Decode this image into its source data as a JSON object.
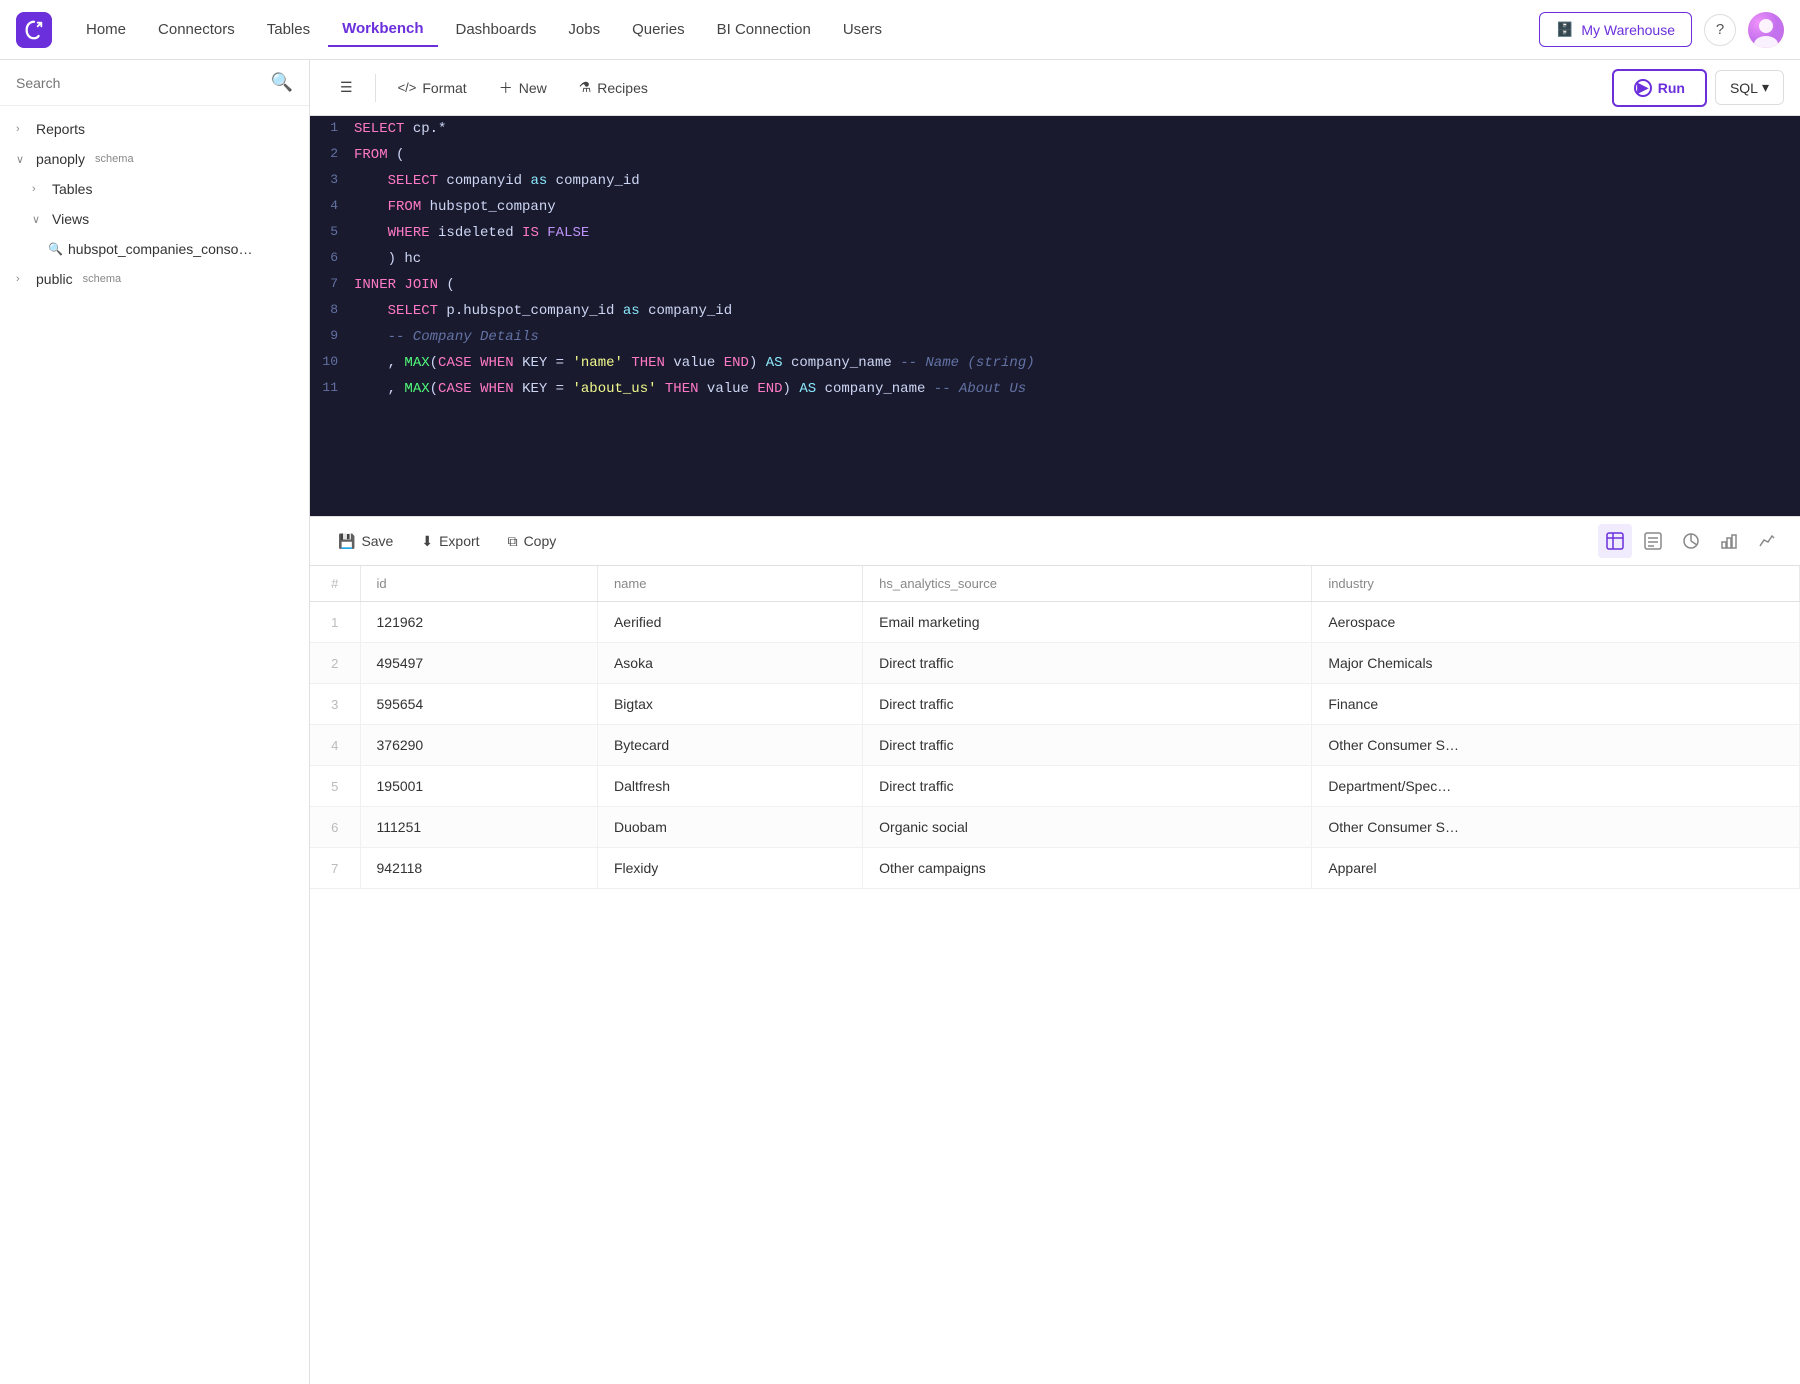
{
  "nav": {
    "items": [
      {
        "label": "Home",
        "active": false
      },
      {
        "label": "Connectors",
        "active": false
      },
      {
        "label": "Tables",
        "active": false
      },
      {
        "label": "Workbench",
        "active": true
      },
      {
        "label": "Dashboards",
        "active": false
      },
      {
        "label": "Jobs",
        "active": false
      },
      {
        "label": "Queries",
        "active": false
      },
      {
        "label": "BI Connection",
        "active": false
      },
      {
        "label": "Users",
        "active": false
      }
    ],
    "warehouse_label": "My Warehouse",
    "help_icon": "?",
    "run_label": "Run",
    "sql_label": "SQL"
  },
  "sidebar": {
    "search_placeholder": "Search",
    "tree": [
      {
        "id": "reports",
        "label": "Reports",
        "level": 0,
        "chevron": "›",
        "expanded": false
      },
      {
        "id": "panoply",
        "label": "panoply",
        "badge": "schema",
        "level": 0,
        "chevron": "∨",
        "expanded": true
      },
      {
        "id": "tables",
        "label": "Tables",
        "level": 1,
        "chevron": "›",
        "expanded": false
      },
      {
        "id": "views",
        "label": "Views",
        "level": 1,
        "chevron": "∨",
        "expanded": true
      },
      {
        "id": "hubspot",
        "label": "hubspot_companies_conso…",
        "level": 2,
        "icon": "search"
      },
      {
        "id": "public",
        "label": "public",
        "badge": "schema",
        "level": 0,
        "chevron": "›",
        "expanded": false
      }
    ]
  },
  "toolbar": {
    "format_label": "Format",
    "new_label": "New",
    "recipes_label": "Recipes"
  },
  "code_lines": [
    {
      "num": 1,
      "tokens": [
        {
          "t": "kw",
          "v": "SELECT"
        },
        {
          "t": "ident",
          "v": " cp.*"
        }
      ]
    },
    {
      "num": 2,
      "tokens": [
        {
          "t": "kw",
          "v": "FROM"
        },
        {
          "t": "ident",
          "v": " ("
        }
      ]
    },
    {
      "num": 3,
      "tokens": [
        {
          "t": "",
          "v": "    "
        },
        {
          "t": "kw",
          "v": "SELECT"
        },
        {
          "t": "ident",
          "v": " companyid "
        },
        {
          "t": "kw2",
          "v": "as"
        },
        {
          "t": "ident",
          "v": " company_id"
        }
      ]
    },
    {
      "num": 4,
      "tokens": [
        {
          "t": "",
          "v": "    "
        },
        {
          "t": "kw",
          "v": "FROM"
        },
        {
          "t": "ident",
          "v": " hubspot_company"
        }
      ]
    },
    {
      "num": 5,
      "tokens": [
        {
          "t": "",
          "v": "    "
        },
        {
          "t": "kw",
          "v": "WHERE"
        },
        {
          "t": "ident",
          "v": " isdeleted "
        },
        {
          "t": "kw",
          "v": "IS"
        },
        {
          "t": "val",
          "v": " FALSE"
        }
      ]
    },
    {
      "num": 6,
      "tokens": [
        {
          "t": "ident",
          "v": "    ) hc"
        }
      ]
    },
    {
      "num": 7,
      "tokens": [
        {
          "t": "kw",
          "v": "INNER"
        },
        {
          "t": "ident",
          "v": " "
        },
        {
          "t": "kw",
          "v": "JOIN"
        },
        {
          "t": "ident",
          "v": " ("
        }
      ]
    },
    {
      "num": 8,
      "tokens": [
        {
          "t": "",
          "v": "    "
        },
        {
          "t": "kw",
          "v": "SELECT"
        },
        {
          "t": "ident",
          "v": " p.hubspot_company_id "
        },
        {
          "t": "kw2",
          "v": "as"
        },
        {
          "t": "ident",
          "v": " company_id"
        }
      ]
    },
    {
      "num": 9,
      "tokens": [
        {
          "t": "comment",
          "v": "    -- Company Details"
        }
      ]
    },
    {
      "num": 10,
      "tokens": [
        {
          "t": "",
          "v": "    "
        },
        {
          "t": "ident",
          "v": ", "
        },
        {
          "t": "fn",
          "v": "MAX"
        },
        {
          "t": "ident",
          "v": "("
        },
        {
          "t": "kw",
          "v": "CASE"
        },
        {
          "t": "ident",
          "v": " "
        },
        {
          "t": "kw",
          "v": "WHEN"
        },
        {
          "t": "ident",
          "v": " KEY = "
        },
        {
          "t": "str",
          "v": "'name'"
        },
        {
          "t": "ident",
          "v": " "
        },
        {
          "t": "kw",
          "v": "THEN"
        },
        {
          "t": "ident",
          "v": " value "
        },
        {
          "t": "kw",
          "v": "END"
        },
        {
          "t": "ident",
          "v": ") "
        },
        {
          "t": "kw2",
          "v": "AS"
        },
        {
          "t": "ident",
          "v": " company_name "
        },
        {
          "t": "comment",
          "v": "-- Name (string)"
        }
      ]
    },
    {
      "num": 11,
      "tokens": [
        {
          "t": "",
          "v": "    "
        },
        {
          "t": "ident",
          "v": ", "
        },
        {
          "t": "fn",
          "v": "MAX"
        },
        {
          "t": "ident",
          "v": "("
        },
        {
          "t": "kw",
          "v": "CASE"
        },
        {
          "t": "ident",
          "v": " "
        },
        {
          "t": "kw",
          "v": "WHEN"
        },
        {
          "t": "ident",
          "v": " KEY = "
        },
        {
          "t": "str",
          "v": "'about_us'"
        },
        {
          "t": "ident",
          "v": " "
        },
        {
          "t": "kw",
          "v": "THEN"
        },
        {
          "t": "ident",
          "v": " value "
        },
        {
          "t": "kw",
          "v": "END"
        },
        {
          "t": "ident",
          "v": ") "
        },
        {
          "t": "kw2",
          "v": "AS"
        },
        {
          "t": "ident",
          "v": " company_name "
        },
        {
          "t": "comment",
          "v": "-- About Us"
        }
      ]
    }
  ],
  "results": {
    "save_label": "Save",
    "export_label": "Export",
    "copy_label": "Copy",
    "columns": [
      "#",
      "id",
      "name",
      "hs_analytics_source",
      "industry"
    ],
    "rows": [
      {
        "num": 1,
        "id": "121962",
        "name": "Aerified",
        "hs_analytics_source": "Email marketing",
        "industry": "Aerospace"
      },
      {
        "num": 2,
        "id": "495497",
        "name": "Asoka",
        "hs_analytics_source": "Direct traffic",
        "industry": "Major Chemicals"
      },
      {
        "num": 3,
        "id": "595654",
        "name": "Bigtax",
        "hs_analytics_source": "Direct traffic",
        "industry": "Finance"
      },
      {
        "num": 4,
        "id": "376290",
        "name": "Bytecard",
        "hs_analytics_source": "Direct traffic",
        "industry": "Other Consumer S…"
      },
      {
        "num": 5,
        "id": "195001",
        "name": "Daltfresh",
        "hs_analytics_source": "Direct traffic",
        "industry": "Department/Spec…"
      },
      {
        "num": 6,
        "id": "111251",
        "name": "Duobam",
        "hs_analytics_source": "Organic social",
        "industry": "Other Consumer S…"
      },
      {
        "num": 7,
        "id": "942118",
        "name": "Flexidy",
        "hs_analytics_source": "Other campaigns",
        "industry": "Apparel"
      }
    ]
  }
}
